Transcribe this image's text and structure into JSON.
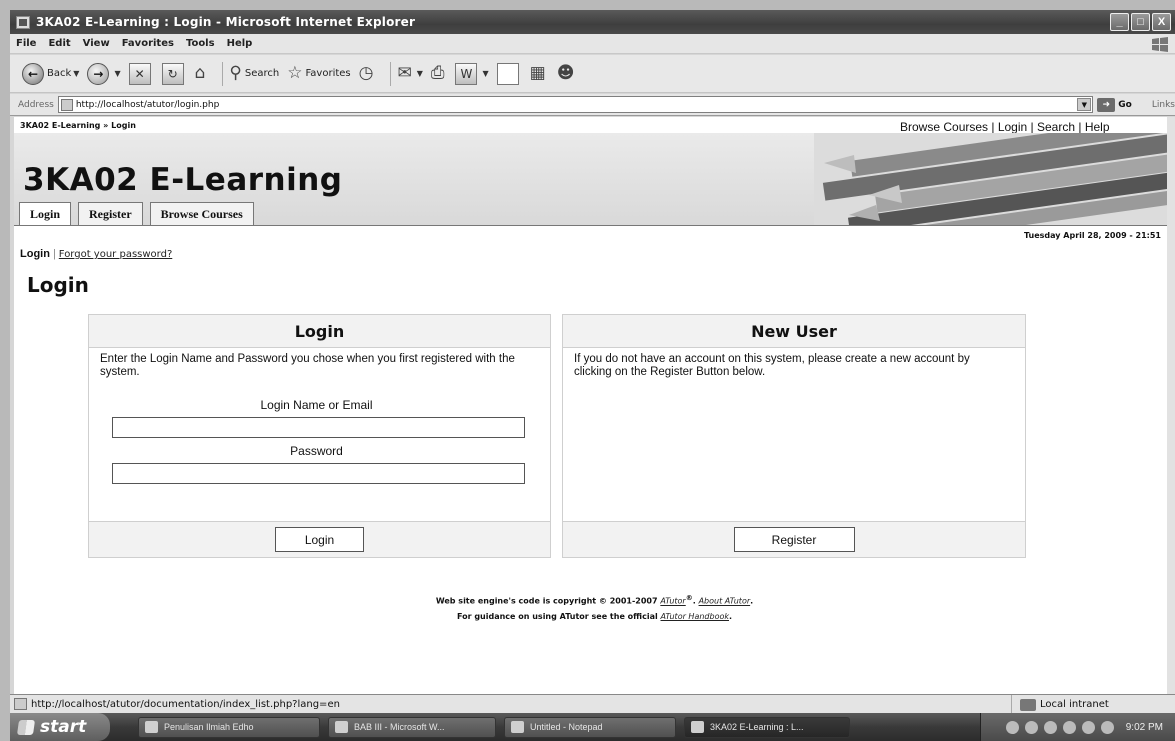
{
  "window": {
    "title": "3KA02 E-Learning : Login - Microsoft Internet Explorer",
    "buttons": [
      "_",
      "□",
      "X"
    ]
  },
  "menubar": [
    "File",
    "Edit",
    "View",
    "Favorites",
    "Tools",
    "Help"
  ],
  "toolbar": {
    "back": "Back",
    "search": "Search",
    "favorites": "Favorites"
  },
  "address": {
    "label": "Address",
    "url": "http://localhost/atutor/login.php",
    "go": "Go",
    "links": "Links"
  },
  "page": {
    "breadcrumb": "3KA02 E-Learning » Login",
    "top_links": [
      "Browse Courses",
      "Login",
      "Search",
      "Help"
    ],
    "site_title": "3KA02 E-Learning",
    "tabs": [
      {
        "label": "Login",
        "active": true
      },
      {
        "label": "Register",
        "active": false
      },
      {
        "label": "Browse Courses",
        "active": false
      }
    ],
    "date": "Tuesday April 28, 2009 - 21:51",
    "subnav": {
      "current": "Login",
      "link": "Forgot your password?"
    },
    "heading": "Login",
    "login_box": {
      "title": "Login",
      "description": "Enter the Login Name and Password you chose when you first registered with the system.",
      "name_label": "Login Name or Email",
      "password_label": "Password",
      "button": "Login"
    },
    "new_user_box": {
      "title": "New User",
      "description": "If you do not have an account on this system, please create a new account by clicking on the Register Button below.",
      "button": "Register"
    },
    "footer": {
      "copyright": "Web site engine's code is copyright © 2001-2007",
      "atutor_link": "ATutor",
      "reg_mark": "®",
      "about_link": "About ATutor",
      "guidance_prefix": "For guidance on using ATutor see the official",
      "handbook_link": "ATutor Handbook"
    }
  },
  "statusbar": {
    "url": "http://localhost/atutor/documentation/index_list.php?lang=en",
    "zone": "Local intranet"
  },
  "taskbar": {
    "start": "start",
    "tasks": [
      {
        "label": "Penulisan Ilmiah Edho",
        "active": false
      },
      {
        "label": "BAB III - Microsoft W...",
        "active": false
      },
      {
        "label": "Untitled - Notepad",
        "active": false
      },
      {
        "label": "3KA02 E-Learning : L...",
        "active": true
      }
    ],
    "clock": "9:02 PM"
  }
}
